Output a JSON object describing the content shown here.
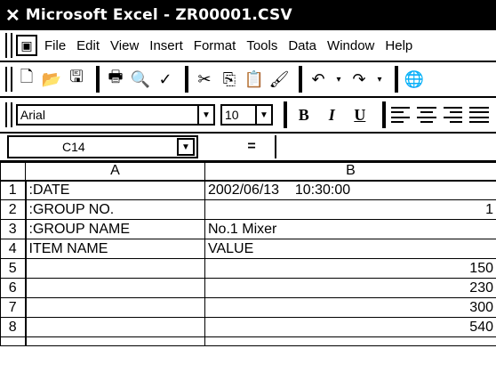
{
  "window": {
    "title": "Microsoft Excel - ZR00001.CSV",
    "icon": "excel-icon"
  },
  "menu": {
    "items": [
      {
        "name": "file",
        "label": "File"
      },
      {
        "name": "edit",
        "label": "Edit"
      },
      {
        "name": "view",
        "label": "View"
      },
      {
        "name": "insert",
        "label": "Insert"
      },
      {
        "name": "format",
        "label": "Format"
      },
      {
        "name": "tools",
        "label": "Tools"
      },
      {
        "name": "data",
        "label": "Data"
      },
      {
        "name": "window",
        "label": "Window"
      },
      {
        "name": "help",
        "label": "Help"
      }
    ]
  },
  "format_toolbar": {
    "font": "Arial",
    "size": "10",
    "bold": "B",
    "italic": "I",
    "underline": "U"
  },
  "formula_bar": {
    "cell_ref": "C14",
    "equals": "=",
    "value": ""
  },
  "sheet": {
    "columns": [
      "A",
      "B"
    ],
    "rows": [
      {
        "num": "1",
        "a": ":DATE",
        "b": "2002/06/13    10:30:00",
        "b_align": "left"
      },
      {
        "num": "2",
        "a": ":GROUP NO.",
        "b": "1",
        "b_align": "right"
      },
      {
        "num": "3",
        "a": ":GROUP NAME",
        "b": "No.1 Mixer",
        "b_align": "left"
      },
      {
        "num": "4",
        "a": "ITEM NAME",
        "b": "VALUE",
        "b_align": "left"
      },
      {
        "num": "5",
        "a": "",
        "b": "150",
        "b_align": "right"
      },
      {
        "num": "6",
        "a": "",
        "b": "230",
        "b_align": "right"
      },
      {
        "num": "7",
        "a": "",
        "b": "300",
        "b_align": "right"
      },
      {
        "num": "8",
        "a": "",
        "b": "540",
        "b_align": "right"
      }
    ]
  }
}
